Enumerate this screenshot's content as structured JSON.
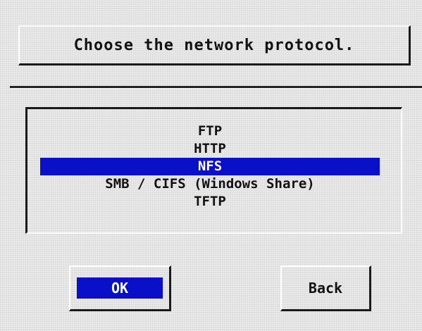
{
  "dialog": {
    "title": "Choose the network protocol."
  },
  "protocols": {
    "items": [
      {
        "label": "FTP",
        "selected": false
      },
      {
        "label": "HTTP",
        "selected": false
      },
      {
        "label": "NFS",
        "selected": true
      },
      {
        "label": "SMB / CIFS (Windows Share)",
        "selected": false
      },
      {
        "label": "TFTP",
        "selected": false
      }
    ]
  },
  "buttons": {
    "ok_label": "OK",
    "back_label": "Back"
  },
  "colors": {
    "selection": "#0a10c8",
    "background": "#e3e3e3"
  }
}
